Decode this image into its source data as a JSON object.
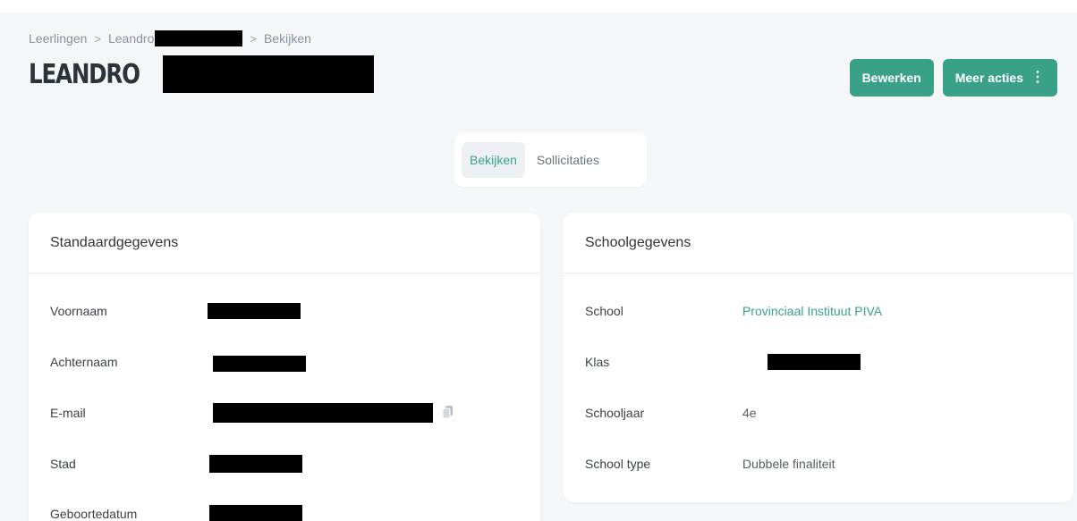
{
  "breadcrumb": {
    "items": [
      "Leerlingen",
      "Leandro",
      "Bekijken"
    ],
    "separator": ">"
  },
  "page": {
    "title": "LEANDRO"
  },
  "actions": {
    "edit_label": "Bewerken",
    "more_label": "Meer acties",
    "more_icon": "⋮"
  },
  "tabs": [
    {
      "label": "Bekijken",
      "active": true
    },
    {
      "label": "Sollicitaties",
      "active": false
    }
  ],
  "standard": {
    "title": "Standaardgegevens",
    "fields": [
      {
        "label": "Voornaam"
      },
      {
        "label": "Achternaam"
      },
      {
        "label": "E-mail"
      },
      {
        "label": "Stad"
      },
      {
        "label": "Geboortedatum"
      }
    ]
  },
  "school": {
    "title": "Schoolgegevens",
    "fields": [
      {
        "label": "School",
        "value": "Provinciaal Instituut PIVA"
      },
      {
        "label": "Klas",
        "value": ""
      },
      {
        "label": "Schooljaar",
        "value": "4e"
      },
      {
        "label": "School type",
        "value": "Dubbele finaliteit"
      }
    ]
  },
  "colors": {
    "accent": "#3aa189",
    "background": "#f4f6f8",
    "redaction": "#000000"
  },
  "icons": {
    "copy": "copy-icon",
    "chevron": "chevron-right-icon",
    "more": "kebab-icon"
  }
}
